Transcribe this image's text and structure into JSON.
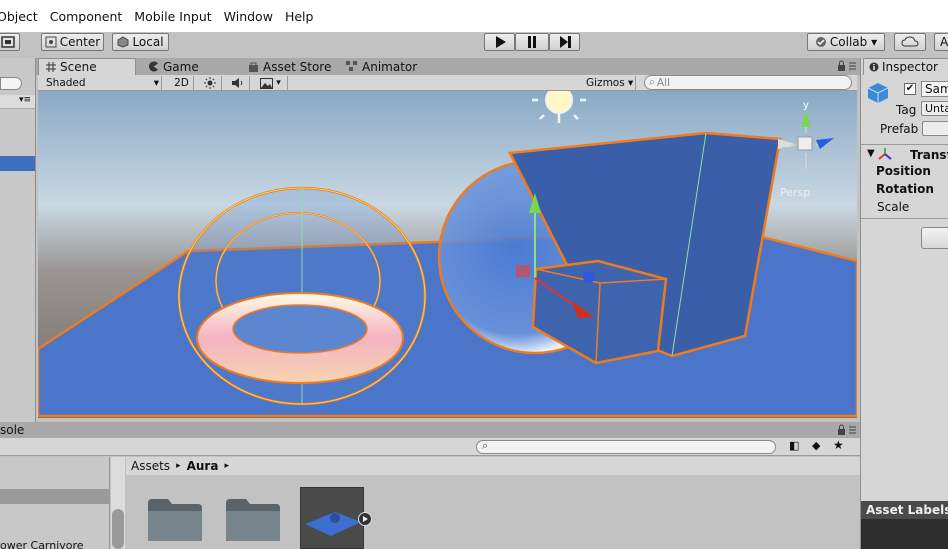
{
  "menu": {
    "items": [
      "Object",
      "Component",
      "Mobile Input",
      "Window",
      "Help"
    ]
  },
  "toolbar": {
    "pivot_label": "Center",
    "space_label": "Local",
    "collab_label": "Collab ▾",
    "account_label": "A"
  },
  "window_tabs": {
    "scene": "Scene",
    "game": "Game",
    "asset_store": "Asset Store",
    "animator": "Animator"
  },
  "scene_toolbar": {
    "draw_mode": "Shaded",
    "mode_2d": "2D",
    "gizmos": "Gizmos ▾",
    "search_placeholder": "All"
  },
  "scene_view": {
    "projection_label": "Persp",
    "gizmo_axis_y": "y"
  },
  "inspector": {
    "tab": "Inspector",
    "object_name": "Sam",
    "tag_label": "Tag",
    "tag_value": "Unta",
    "prefab_label": "Prefab",
    "component_title": "Transf",
    "position_label": "Position",
    "rotation_label": "Rotation",
    "scale_label": "Scale",
    "asset_labels": "Asset Labels"
  },
  "console_tab": "sole",
  "project": {
    "breadcrumb_root": "Assets",
    "breadcrumb_current": "Aura",
    "list_item": "ower Carnivore"
  },
  "colors": {
    "accent_blue": "#3d6fbf",
    "selection_orange": "#f07b1c",
    "panel_bg": "#c2c2c2",
    "ground_blue": "#4a75c8"
  }
}
